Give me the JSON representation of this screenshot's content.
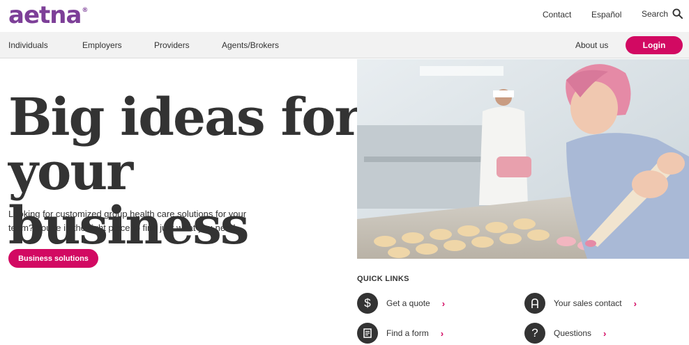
{
  "brand": {
    "logo_text": "aetna",
    "logo_mark": "®",
    "color": "#7d3f98"
  },
  "utility_nav": {
    "contact": "Contact",
    "espanol": "Español",
    "search": "Search"
  },
  "main_nav": {
    "items": [
      "Individuals",
      "Employers",
      "Providers",
      "Agents/Brokers"
    ],
    "about": "About us",
    "login": "Login"
  },
  "hero": {
    "title_line1": "Big ideas for",
    "title_line2": "your business",
    "subtitle": "Looking for customized group health care solutions for your team? You're in the right place to find just what you need.",
    "cta": "Business solutions"
  },
  "quick_links": {
    "heading": "QUICK LINKS",
    "items": [
      {
        "label": "Get a quote",
        "icon": "dollar-icon"
      },
      {
        "label": "Your sales contact",
        "icon": "person-icon"
      },
      {
        "label": "Find a form",
        "icon": "document-icon"
      },
      {
        "label": "Questions",
        "icon": "question-icon"
      }
    ]
  },
  "colors": {
    "accent": "#d20962",
    "text": "#333333",
    "nav_bg": "#f2f2f2"
  }
}
